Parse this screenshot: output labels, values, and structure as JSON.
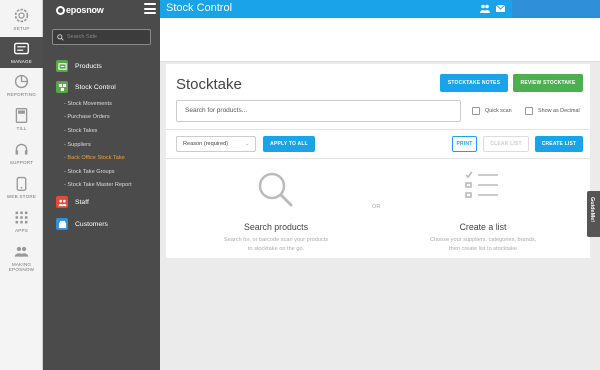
{
  "rail": {
    "items": [
      {
        "label": "SETUP",
        "icon": "gear-icon"
      },
      {
        "label": "MANAGE",
        "icon": "manage-icon"
      },
      {
        "label": "REPORTING",
        "icon": "pie-chart-icon"
      },
      {
        "label": "TILL",
        "icon": "till-icon"
      },
      {
        "label": "SUPPORT",
        "icon": "headset-icon"
      },
      {
        "label": "WEB STORE",
        "icon": "store-icon"
      },
      {
        "label": "APPS",
        "icon": "grid-icon"
      },
      {
        "label": "MAKING EPOSNOW",
        "icon": "people-icon"
      }
    ]
  },
  "sidebar": {
    "logo": "eposnow",
    "search_placeholder": "Search Side",
    "groups": {
      "products": "Products",
      "stock_control": "Stock Control",
      "staff": "Staff",
      "customers": "Customers"
    },
    "stock_items": [
      "Stock Movements",
      "Purchase Orders",
      "Stock Takes",
      "Suppliers",
      "Back Office Stock Take",
      "Stock Take Groups",
      "Stock Take Master Report"
    ],
    "active_item": "Back Office Stock Take"
  },
  "header": {
    "title": "Stock Control"
  },
  "main": {
    "title": "Stocktake",
    "stocktake_notes": "STOCKTAKE NOTES",
    "review_stocktake": "REVIEW STOCKTAKE",
    "search_placeholder": "Search for products...",
    "quick_scan": "Quick scan",
    "show_decimal": "Show as Decimal",
    "reason": "Reason (required)",
    "apply_to_all": "APPLY TO ALL",
    "print": "PRINT",
    "clear_list": "CLEAR LIST",
    "create_list": "CREATE LIST",
    "search_products_head": "Search products",
    "search_products_line1": "Search for, or barcode scan your products",
    "search_products_line2": "to stocktake on the go.",
    "or": "OR",
    "create_list_head": "Create a list",
    "create_list_line1": "Choose your suppliers, categories, brands,",
    "create_list_line2": "then create list to stocktake"
  },
  "guideme": "GuideMe!",
  "colors": {
    "blue": "#1aa3e8",
    "green": "#4caf50",
    "sidebar": "#4b4b4b",
    "orange": "#f0a030"
  }
}
